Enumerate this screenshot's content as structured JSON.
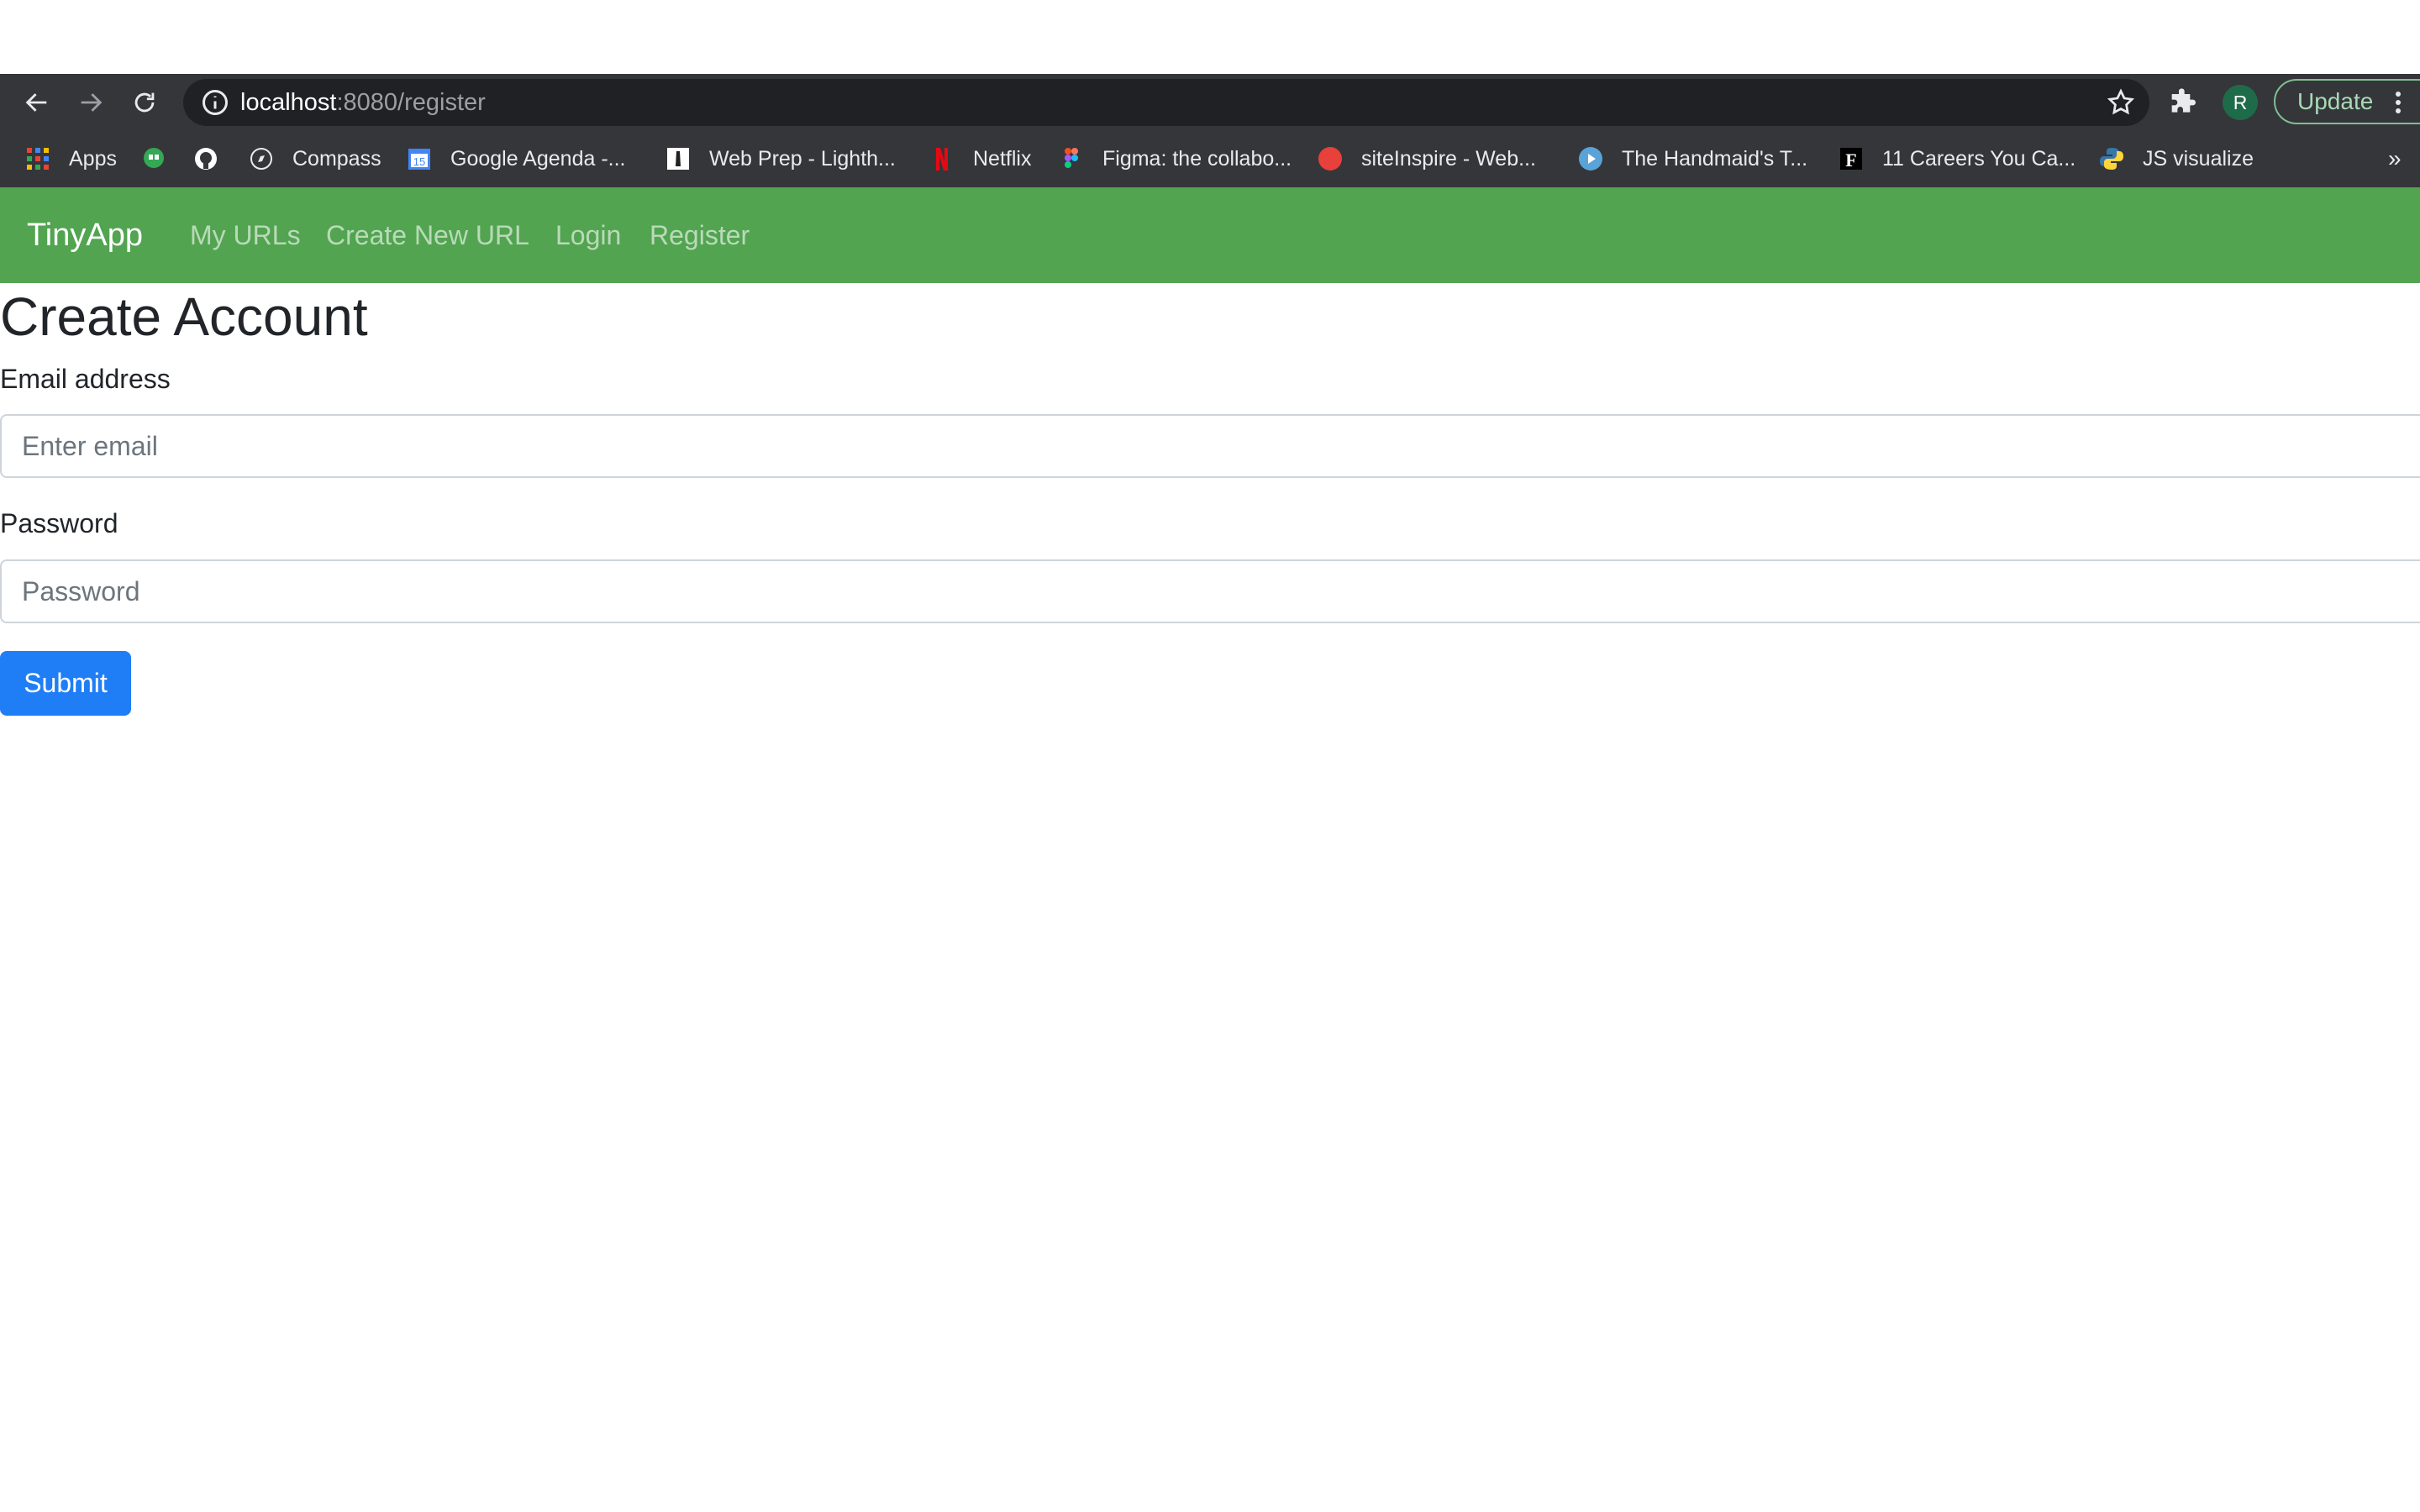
{
  "browser": {
    "url_host": "localhost",
    "url_path": ":8080/register",
    "profile_initial": "R",
    "update_label": "Update",
    "more_bookmarks": "»",
    "bookmarks": [
      {
        "label": "Apps",
        "icon": "apps-grid-icon"
      },
      {
        "label": "",
        "icon": "hangouts-icon"
      },
      {
        "label": "",
        "icon": "github-icon"
      },
      {
        "label": "Compass",
        "icon": "compass-icon"
      },
      {
        "label": "Google Agenda -...",
        "icon": "calendar-icon"
      },
      {
        "label": "Web Prep - Lighth...",
        "icon": "lighthouse-icon"
      },
      {
        "label": "Netflix",
        "icon": "netflix-icon"
      },
      {
        "label": "Figma: the collabo...",
        "icon": "figma-icon"
      },
      {
        "label": "siteInspire - Web...",
        "icon": "siteinspire-icon"
      },
      {
        "label": "The Handmaid's T...",
        "icon": "play-icon"
      },
      {
        "label": "11 Careers You Ca...",
        "icon": "f-icon"
      },
      {
        "label": "JS visualize",
        "icon": "python-icon"
      }
    ]
  },
  "navbar": {
    "brand": "TinyApp",
    "links": [
      "My URLs",
      "Create New URL",
      "Login",
      "Register"
    ]
  },
  "form": {
    "title": "Create Account",
    "email_label": "Email address",
    "email_placeholder": "Enter email",
    "password_label": "Password",
    "password_placeholder": "Password",
    "submit_label": "Submit"
  },
  "colors": {
    "navbar": "#52a450",
    "submit": "#1f7ef5",
    "chrome": "#35363a"
  }
}
